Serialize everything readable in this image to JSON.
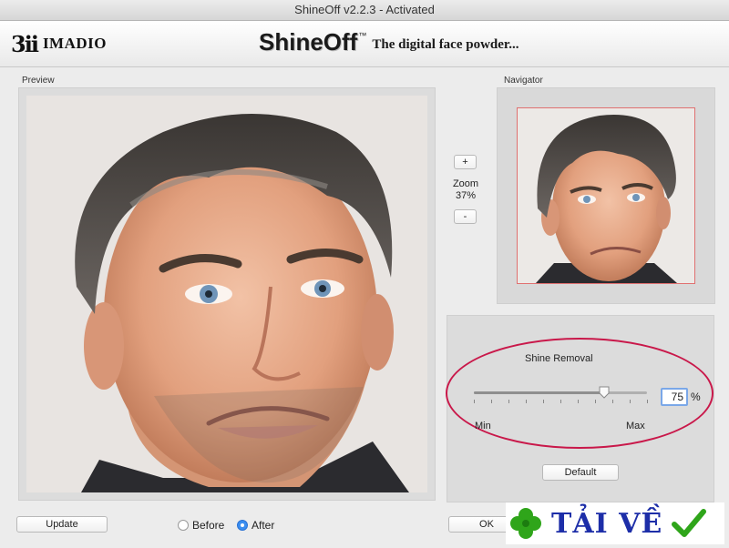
{
  "window": {
    "title": "ShineOff v2.2.3 - Activated"
  },
  "banner": {
    "brand_logo": "3ii",
    "brand_name": "IMADIO",
    "product_name": "ShineOff",
    "product_tm": "™",
    "tagline": "The digital face powder..."
  },
  "preview": {
    "label": "Preview"
  },
  "navigator": {
    "label": "Navigator"
  },
  "zoom": {
    "plus": "+",
    "minus": "-",
    "label": "Zoom",
    "value": "37%"
  },
  "shine": {
    "title": "Shine Removal",
    "value": "75",
    "value_fraction": 0.75,
    "unit": "%",
    "min_label": "Min",
    "max_label": "Max",
    "default_label": "Default"
  },
  "bottom": {
    "update_label": "Update",
    "before_label": "Before",
    "after_label": "After",
    "selected": "After",
    "ok_label": "OK"
  },
  "watermark": {
    "text": "TẢI VỀ"
  },
  "colors": {
    "accent": "#3b8ef0",
    "annotation": "#c9184a",
    "nav_frame": "#e07070"
  }
}
